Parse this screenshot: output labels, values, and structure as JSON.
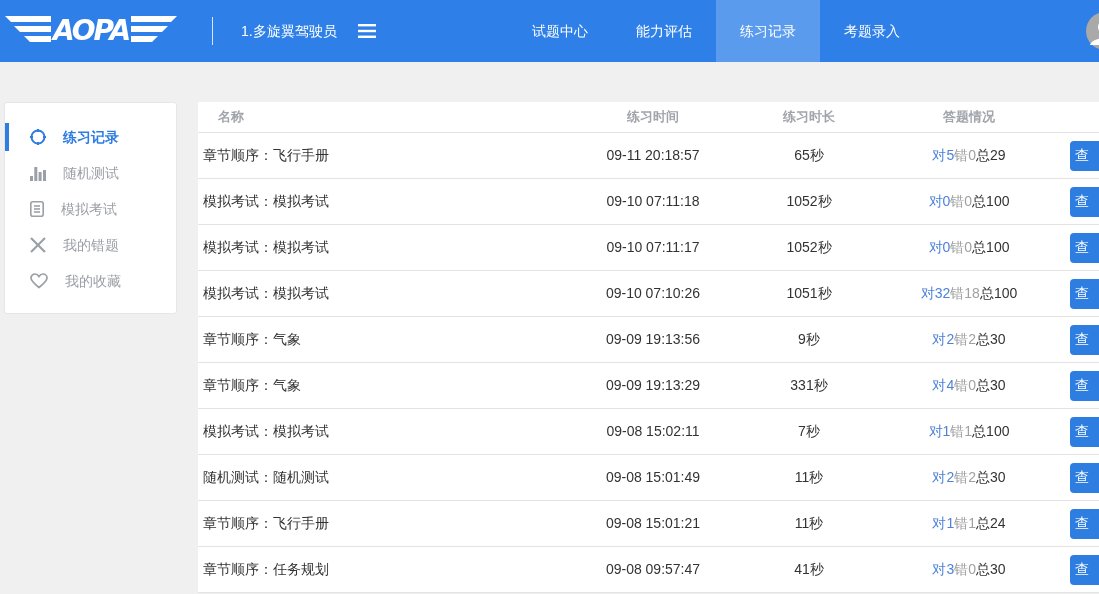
{
  "header": {
    "logo": "AOPA",
    "subject": "1.多旋翼驾驶员",
    "nav": [
      {
        "label": "试题中心",
        "selected": false
      },
      {
        "label": "能力评估",
        "selected": false
      },
      {
        "label": "练习记录",
        "selected": true
      },
      {
        "label": "考题录入",
        "selected": false
      }
    ]
  },
  "sidebar": {
    "items": [
      {
        "label": "练习记录",
        "selected": true
      },
      {
        "label": "随机测试",
        "selected": false
      },
      {
        "label": "模拟考试",
        "selected": false
      },
      {
        "label": "我的错题",
        "selected": false
      },
      {
        "label": "我的收藏",
        "selected": false
      }
    ]
  },
  "table": {
    "columns": [
      "名称",
      "练习时间",
      "练习时长",
      "答题情况"
    ],
    "rows": [
      {
        "name": "章节顺序：飞行手册",
        "time": "09-11 20:18:57",
        "duration": "65秒",
        "answers": {
          "right": "对5",
          "wrong": "错0",
          "total": "总29"
        },
        "action": "查"
      },
      {
        "name": "模拟考试：模拟考试",
        "time": "09-10 07:11:18",
        "duration": "1052秒",
        "answers": {
          "right": "对0",
          "wrong": "错0",
          "total": "总100"
        },
        "action": "查"
      },
      {
        "name": "模拟考试：模拟考试",
        "time": "09-10 07:11:17",
        "duration": "1052秒",
        "answers": {
          "right": "对0",
          "wrong": "错0",
          "total": "总100"
        },
        "action": "查"
      },
      {
        "name": "模拟考试：模拟考试",
        "time": "09-10 07:10:26",
        "duration": "1051秒",
        "answers": {
          "right": "对32",
          "wrong": "错18",
          "total": "总100"
        },
        "action": "查"
      },
      {
        "name": "章节顺序：气象",
        "time": "09-09 19:13:56",
        "duration": "9秒",
        "answers": {
          "right": "对2",
          "wrong": "错2",
          "total": "总30"
        },
        "action": "查"
      },
      {
        "name": "章节顺序：气象",
        "time": "09-09 19:13:29",
        "duration": "331秒",
        "answers": {
          "right": "对4",
          "wrong": "错0",
          "total": "总30"
        },
        "action": "查"
      },
      {
        "name": "模拟考试：模拟考试",
        "time": "09-08 15:02:11",
        "duration": "7秒",
        "answers": {
          "right": "对1",
          "wrong": "错1",
          "total": "总100"
        },
        "action": "查"
      },
      {
        "name": "随机测试：随机测试",
        "time": "09-08 15:01:49",
        "duration": "11秒",
        "answers": {
          "right": "对2",
          "wrong": "错2",
          "total": "总30"
        },
        "action": "查"
      },
      {
        "name": "章节顺序：飞行手册",
        "time": "09-08 15:01:21",
        "duration": "11秒",
        "answers": {
          "right": "对1",
          "wrong": "错1",
          "total": "总24"
        },
        "action": "查"
      },
      {
        "name": "章节顺序：任务规划",
        "time": "09-08 09:57:47",
        "duration": "41秒",
        "answers": {
          "right": "对3",
          "wrong": "错0",
          "total": "总30"
        },
        "action": "查"
      }
    ]
  }
}
